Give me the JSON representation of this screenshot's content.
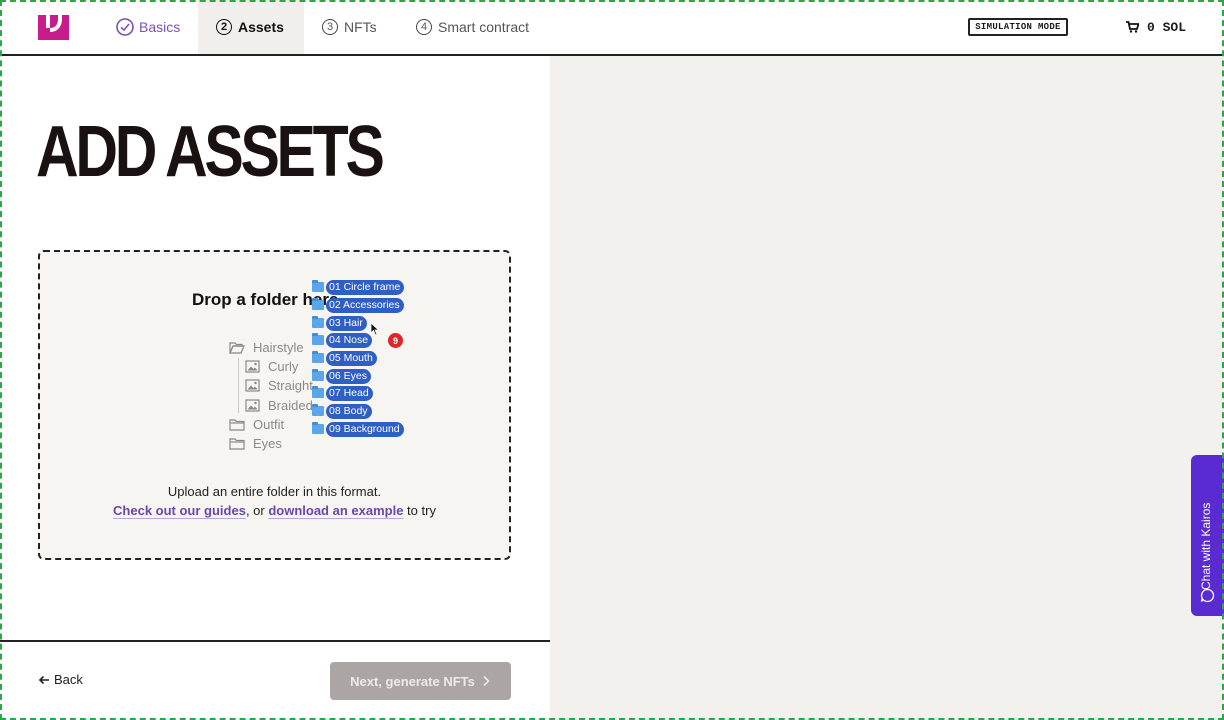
{
  "colors": {
    "brand": "#c81b8c",
    "accent_purple": "#6a46ad",
    "chat_tab": "#5b2bd2",
    "chip_blue": "#2f5fc4",
    "badge_red": "#e0242b",
    "next_button_disabled": "#aba5a3",
    "panel_bg": "#f3f1ed",
    "screen_border": "#2aa845"
  },
  "header": {
    "steps": [
      {
        "number": "✓",
        "label": "Basics",
        "state": "done"
      },
      {
        "number": "2",
        "label": "Assets",
        "state": "active"
      },
      {
        "number": "3",
        "label": "NFTs",
        "state": "upcoming"
      },
      {
        "number": "4",
        "label": "Smart contract",
        "state": "upcoming"
      }
    ],
    "simulation_badge": "SIMULATION MODE",
    "cart_value": "0 SOL"
  },
  "main": {
    "title": "ADD ASSETS",
    "dropzone": {
      "heading": "Drop a folder here",
      "tree": [
        {
          "label": "Hairstyle",
          "icon": "folder-open-icon"
        },
        {
          "label": "Curly",
          "icon": "image-icon"
        },
        {
          "label": "Straight",
          "icon": "image-icon"
        },
        {
          "label": "Braided",
          "icon": "image-icon"
        },
        {
          "label": "Outfit",
          "icon": "folder-icon"
        },
        {
          "label": "Eyes",
          "icon": "folder-icon"
        }
      ],
      "upload_text": "Upload an entire folder in this format.",
      "guides_link": "Check out our guides",
      "separator_text": ", or ",
      "example_link": "download an example",
      "trailing_text": " to try"
    },
    "dragged_folders": [
      "01 Circle frame",
      "02 Accessories",
      "03 Hair",
      "04 Nose",
      "05 Mouth",
      "06 Eyes",
      "07 Head",
      "08 Body",
      "09 Background"
    ],
    "dragged_count": "9"
  },
  "footer": {
    "back_label": "Back",
    "next_label": "Next, generate NFTs"
  },
  "chat": {
    "label": "Chat with Kairos"
  }
}
